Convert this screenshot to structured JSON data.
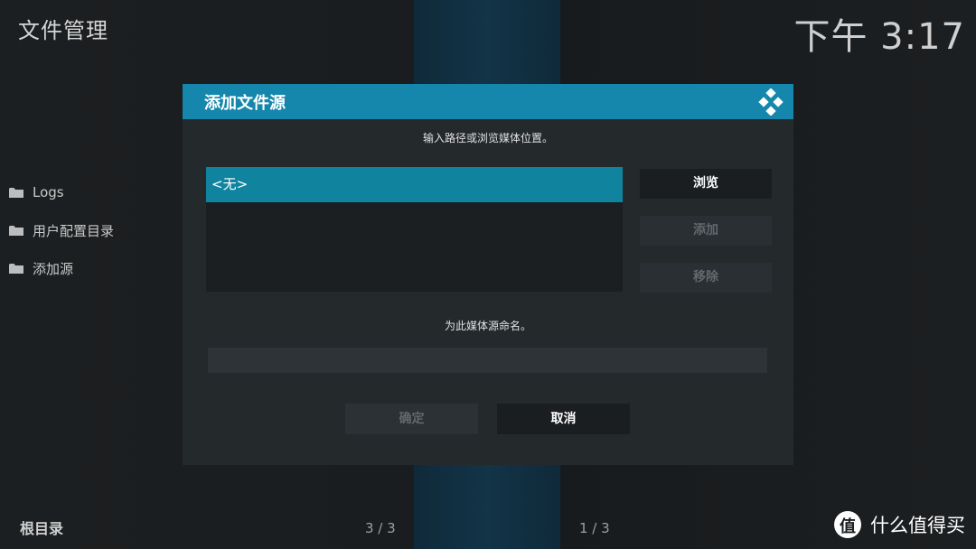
{
  "header": {
    "app_title": "文件管理",
    "clock": "下午 3:17"
  },
  "sidebar": {
    "items": [
      {
        "label": "Logs",
        "icon": "folder-icon"
      },
      {
        "label": "用户配置目录",
        "icon": "folder-icon"
      },
      {
        "label": "添加源",
        "icon": "folder-icon"
      }
    ]
  },
  "footer": {
    "location": "根目录",
    "left_count": "3 / 3",
    "right_count": "1 / 3",
    "watermark_badge": "值",
    "watermark_text": "什么值得买"
  },
  "dialog": {
    "title": "添加文件源",
    "logo_icon": "kodi-logo-icon",
    "instruction": "输入路径或浏览媒体位置。",
    "paths": [
      "<无>"
    ],
    "browse_label": "浏览",
    "add_label": "添加",
    "remove_label": "移除",
    "name_label": "为此媒体源命名。",
    "name_value": "",
    "ok_label": "确定",
    "cancel_label": "取消"
  },
  "colors": {
    "accent": "#1587ac",
    "selection": "#10849f",
    "dialog_bg": "#24292c",
    "page_bg": "#1a1d1f"
  }
}
